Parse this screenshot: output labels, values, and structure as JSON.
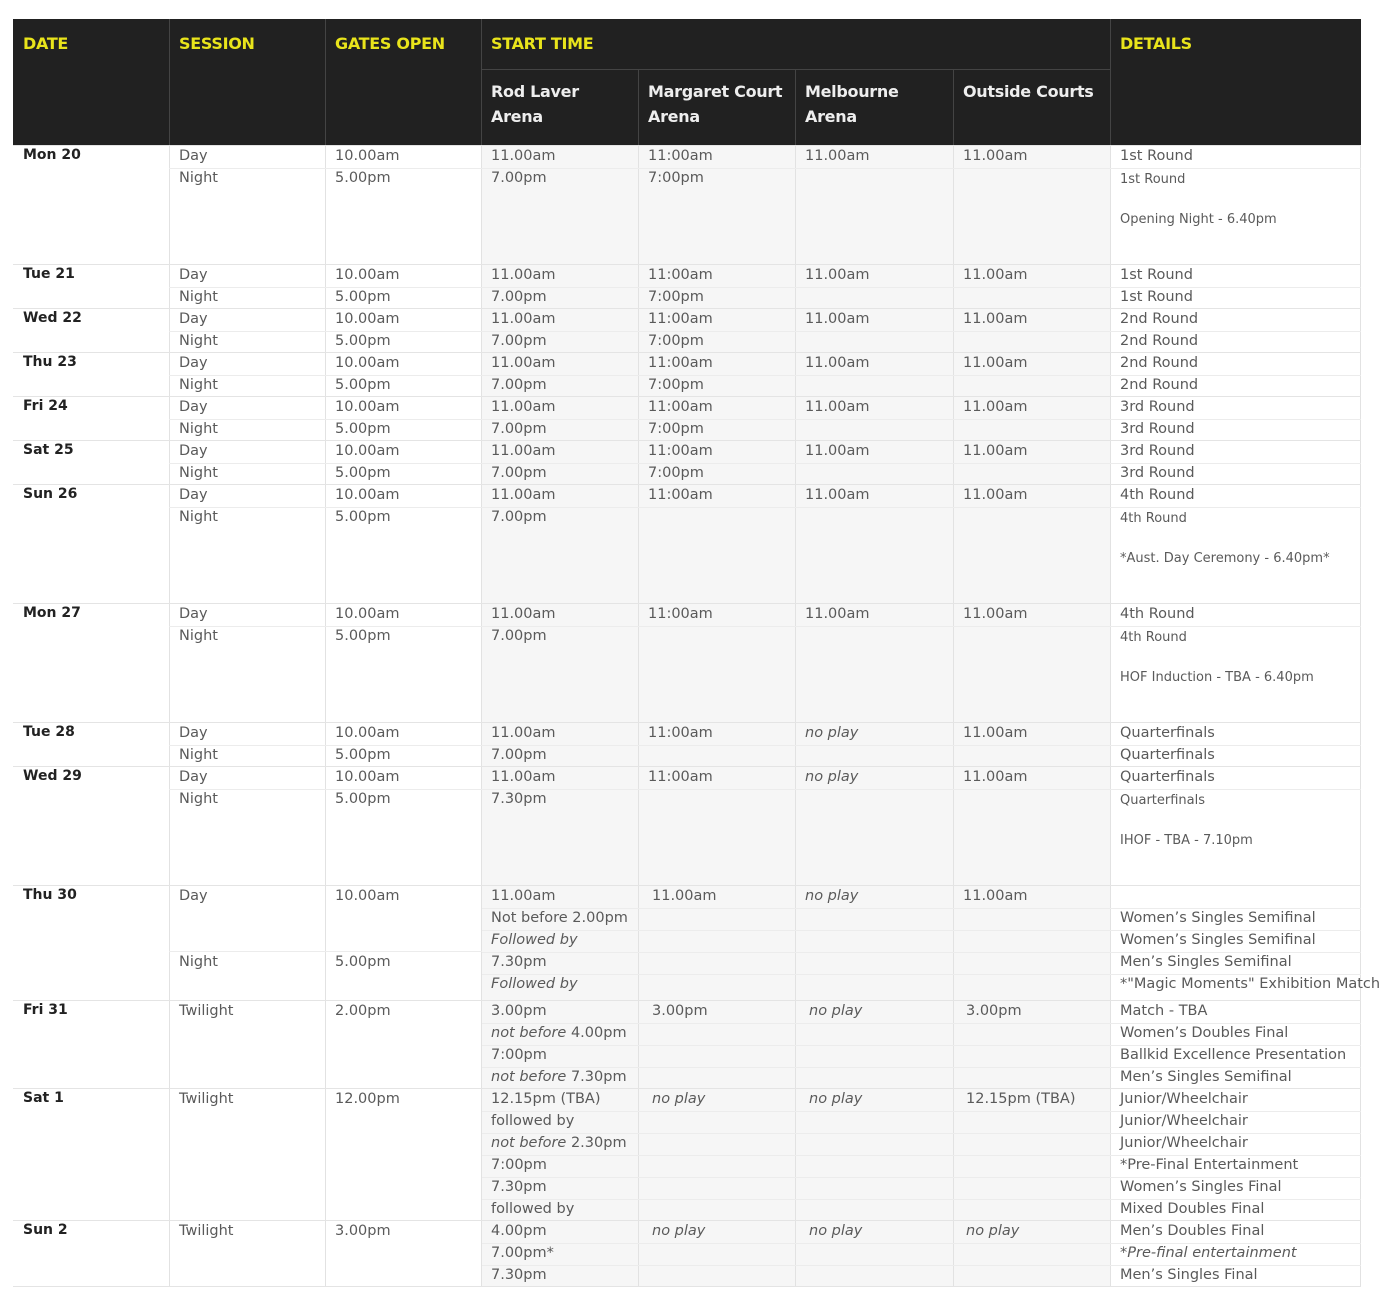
{
  "headers": {
    "date": "DATE",
    "session": "SESSION",
    "gates": "GATES OPEN",
    "start": "START TIME",
    "details": "DETAILS",
    "courts": [
      "Rod Laver Arena",
      "Margaret Court Arena",
      "Melbourne Arena",
      "Outside Courts"
    ]
  },
  "rows": [
    {
      "date": "Mon 20",
      "h": 119,
      "sessions": [
        {
          "name": "Day",
          "gates": "10.00am",
          "rla": [
            "11.00am"
          ],
          "mca": [
            "11:00am"
          ],
          "ma": [
            "11.00am"
          ],
          "oc": [
            "11.00am"
          ],
          "details": [
            "1st Round"
          ]
        },
        {
          "name": "Night",
          "gates": "5.00pm",
          "rla": [
            "7.00pm"
          ],
          "mca": [
            "7:00pm"
          ],
          "ma": [],
          "oc": [],
          "details": [
            "1st Round",
            "",
            "Opening Night - 6.40pm"
          ],
          "detSmall": true
        }
      ]
    },
    {
      "date": "Tue 21",
      "h": 44,
      "sessions": [
        {
          "name": "Day",
          "gates": "10.00am",
          "rla": [
            "11.00am"
          ],
          "mca": [
            "11:00am"
          ],
          "ma": [
            "11.00am"
          ],
          "oc": [
            "11.00am"
          ],
          "details": [
            "1st Round"
          ]
        },
        {
          "name": "Night",
          "gates": "5.00pm",
          "rla": [
            "7.00pm"
          ],
          "mca": [
            "7:00pm"
          ],
          "ma": [],
          "oc": [],
          "details": [
            "1st Round"
          ]
        }
      ]
    },
    {
      "date": "Wed 22",
      "h": 44,
      "sessions": [
        {
          "name": "Day",
          "gates": "10.00am",
          "rla": [
            "11.00am"
          ],
          "mca": [
            "11:00am"
          ],
          "ma": [
            "11.00am"
          ],
          "oc": [
            "11.00am"
          ],
          "details": [
            "2nd Round"
          ]
        },
        {
          "name": "Night",
          "gates": "5.00pm",
          "rla": [
            "7.00pm"
          ],
          "mca": [
            "7:00pm"
          ],
          "ma": [],
          "oc": [],
          "details": [
            "2nd Round"
          ]
        }
      ]
    },
    {
      "date": "Thu 23",
      "h": 44,
      "sessions": [
        {
          "name": "Day",
          "gates": "10.00am",
          "rla": [
            "11.00am"
          ],
          "mca": [
            "11:00am"
          ],
          "ma": [
            "11.00am"
          ],
          "oc": [
            "11.00am"
          ],
          "details": [
            "2nd Round"
          ]
        },
        {
          "name": "Night",
          "gates": "5.00pm",
          "rla": [
            "7.00pm"
          ],
          "mca": [
            "7:00pm"
          ],
          "ma": [],
          "oc": [],
          "details": [
            "2nd Round"
          ]
        }
      ]
    },
    {
      "date": "Fri 24",
      "h": 44,
      "sessions": [
        {
          "name": "Day",
          "gates": "10.00am",
          "rla": [
            "11.00am"
          ],
          "mca": [
            "11:00am"
          ],
          "ma": [
            "11.00am"
          ],
          "oc": [
            "11.00am"
          ],
          "details": [
            "3rd Round"
          ]
        },
        {
          "name": "Night",
          "gates": "5.00pm",
          "rla": [
            "7.00pm"
          ],
          "mca": [
            "7:00pm"
          ],
          "ma": [],
          "oc": [],
          "details": [
            "3rd Round"
          ]
        }
      ]
    },
    {
      "date": "Sat 25",
      "h": 44,
      "sessions": [
        {
          "name": "Day",
          "gates": "10.00am",
          "rla": [
            "11.00am"
          ],
          "mca": [
            "11:00am"
          ],
          "ma": [
            "11.00am"
          ],
          "oc": [
            "11.00am"
          ],
          "details": [
            "3rd Round"
          ]
        },
        {
          "name": "Night",
          "gates": "5.00pm",
          "rla": [
            "7.00pm"
          ],
          "mca": [
            "7:00pm"
          ],
          "ma": [],
          "oc": [],
          "details": [
            "3rd Round"
          ]
        }
      ]
    },
    {
      "date": "Sun 26",
      "h": 119,
      "sessions": [
        {
          "name": "Day",
          "gates": "10.00am",
          "rla": [
            "11.00am"
          ],
          "mca": [
            "11:00am"
          ],
          "ma": [
            "11.00am"
          ],
          "oc": [
            "11.00am"
          ],
          "details": [
            "4th Round"
          ]
        },
        {
          "name": "Night",
          "gates": "5.00pm",
          "rla": [
            "7.00pm"
          ],
          "mca": [],
          "ma": [],
          "oc": [],
          "details": [
            "4th Round",
            "",
            "*Aust. Day Ceremony - 6.40pm*"
          ],
          "detSmall": true
        }
      ]
    },
    {
      "date": "Mon 27",
      "h": 119,
      "sessions": [
        {
          "name": "Day",
          "gates": "10.00am",
          "rla": [
            "11.00am"
          ],
          "mca": [
            "11:00am"
          ],
          "ma": [
            "11.00am"
          ],
          "oc": [
            "11.00am"
          ],
          "details": [
            "4th Round"
          ]
        },
        {
          "name": "Night",
          "gates": "5.00pm",
          "rla": [
            "7.00pm"
          ],
          "mca": [],
          "ma": [],
          "oc": [],
          "details": [
            "4th Round",
            "",
            "HOF Induction - TBA - 6.40pm"
          ],
          "detSmall": true
        }
      ]
    },
    {
      "date": "Tue 28",
      "h": 44,
      "sessions": [
        {
          "name": "Day",
          "gates": "10.00am",
          "rla": [
            "11.00am"
          ],
          "mca": [
            "11:00am"
          ],
          "ma": [
            "no play"
          ],
          "maItalic": true,
          "oc": [
            "11.00am"
          ],
          "details": [
            "Quarterfinals"
          ]
        },
        {
          "name": "Night",
          "gates": "5.00pm",
          "rla": [
            "7.00pm"
          ],
          "mca": [],
          "ma": [],
          "oc": [],
          "details": [
            "Quarterfinals"
          ]
        }
      ]
    },
    {
      "date": "Wed 29",
      "h": 119,
      "sessions": [
        {
          "name": "Day",
          "gates": "10.00am",
          "rla": [
            "11.00am"
          ],
          "mca": [
            "11:00am"
          ],
          "ma": [
            "no play"
          ],
          "maItalic": true,
          "oc": [
            "11.00am"
          ],
          "details": [
            "Quarterfinals"
          ]
        },
        {
          "name": "Night",
          "gates": "5.00pm",
          "rla": [
            "7.30pm"
          ],
          "mca": [],
          "ma": [],
          "oc": [],
          "details": [
            "Quarterfinals",
            "",
            "IHOF - TBA - 7.10pm"
          ],
          "detSmall": true
        }
      ]
    }
  ],
  "thu30": {
    "date": "Thu 30",
    "day": {
      "name": "Day",
      "gates": "10.00am"
    },
    "night": {
      "name": "Night",
      "gates": "5.00pm"
    },
    "rla": [
      "11.00am",
      "Not before 2.00pm",
      "Followed by",
      "7.30pm",
      "Followed by"
    ],
    "mca": "11.00am",
    "ma": "no play",
    "oc": "11.00am",
    "details": [
      "",
      "Women’s Singles Semifinal",
      "Women’s Singles Semifinal",
      "Men’s Singles Semifinal",
      "*\"Magic Moments\" Exhibition Match"
    ]
  },
  "fri31": {
    "date": "Fri 31",
    "session": "Twilight",
    "gates": "2.00pm",
    "rla": [
      "3.00pm",
      "not before 4.00pm",
      "7:00pm",
      "not before 7.30pm"
    ],
    "mca": "3.00pm",
    "ma": "no play",
    "oc": "3.00pm",
    "details": [
      "Match - TBA",
      "Women’s Doubles Final",
      "Ballkid Excellence Presentation",
      "Men’s Singles Semifinal"
    ]
  },
  "sat1": {
    "date": "Sat 1",
    "session": "Twilight",
    "gates": "12.00pm",
    "rla": [
      "12.15pm (TBA)",
      "followed by",
      "not before 2.30pm",
      "7:00pm",
      "7.30pm",
      "followed by"
    ],
    "mca": "no play",
    "ma": "no play",
    "oc": "12.15pm (TBA)",
    "details": [
      "Junior/Wheelchair",
      "Junior/Wheelchair",
      "Junior/Wheelchair",
      "*Pre-Final Entertainment",
      "Women’s Singles Final",
      "Mixed Doubles Final"
    ]
  },
  "sun2": {
    "date": "Sun 2",
    "session": "Twilight",
    "gates": "3.00pm",
    "rla": [
      "4.00pm",
      "7.00pm*",
      "7.30pm"
    ],
    "mca": "no play",
    "ma": "no play",
    "oc": "no play",
    "details": [
      "Men’s Doubles Final",
      "*Pre-final entertainment",
      "Men’s Singles Final"
    ]
  }
}
